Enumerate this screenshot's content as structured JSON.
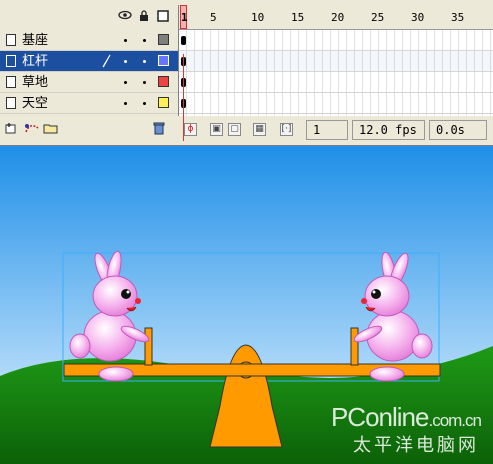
{
  "timeline": {
    "header_icons": [
      "eye-icon",
      "lock-icon",
      "outline-icon"
    ],
    "ruler": {
      "current_frame_marker": "1",
      "labels": [
        "5",
        "10",
        "15",
        "20",
        "25",
        "30",
        "35"
      ]
    },
    "layers": [
      {
        "name": "基座",
        "color": "#7f7f7f",
        "selected": false
      },
      {
        "name": "杠杆",
        "color": "#6677ff",
        "selected": true
      },
      {
        "name": "草地",
        "color": "#ee4444",
        "selected": false
      },
      {
        "name": "天空",
        "color": "#ffee55",
        "selected": false
      }
    ],
    "status": {
      "current_frame": "1",
      "frame_rate": "12.0 fps",
      "elapsed_time": "0.0s"
    }
  },
  "watermark": {
    "brand": "PConline",
    "domain": ".com.cn",
    "chinese": "太平洋电脑网"
  }
}
